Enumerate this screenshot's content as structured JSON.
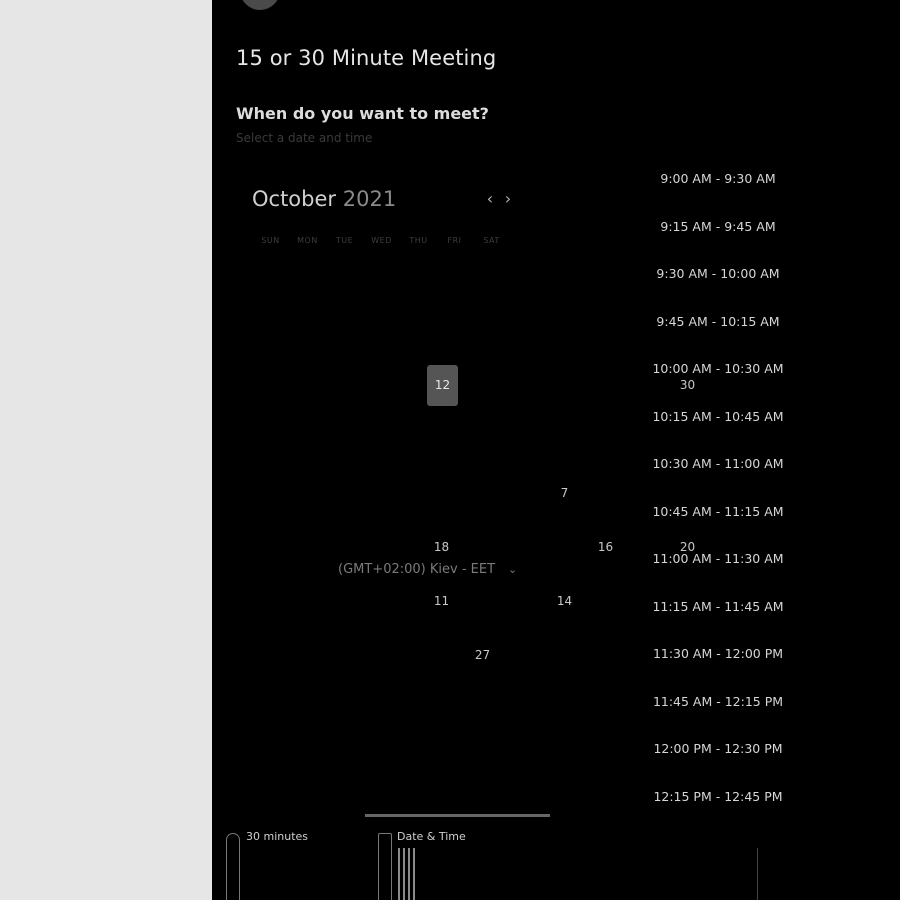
{
  "event": {
    "title": "15 or 30 Minute Meeting",
    "question": "When do you want to meet?",
    "subtitle": "Select a date and time"
  },
  "calendar": {
    "month": "October",
    "year": "2021",
    "prev_icon": "chevron-left-icon",
    "next_icon": "chevron-right-icon",
    "weekdays": [
      "SUN",
      "MON",
      "TUE",
      "WED",
      "THU",
      "FRI",
      "SAT"
    ],
    "days": {
      "selected": "12",
      "d30": "30",
      "d7": "7",
      "d18": "18",
      "d16": "16",
      "d20": "20",
      "d11": "11",
      "d14": "14",
      "d27": "27"
    }
  },
  "timezone": {
    "value": "(GMT+02:00) Kiev - EET",
    "icon": "chevron-down-icon"
  },
  "time_slots": [
    "9:00 AM - 9:30 AM",
    "9:15 AM - 9:45 AM",
    "9:30 AM - 10:00 AM",
    "9:45 AM - 10:15 AM",
    "10:00 AM - 10:30 AM",
    "10:15 AM - 10:45 AM",
    "10:30 AM - 11:00 AM",
    "10:45 AM - 11:15 AM",
    "11:00 AM - 11:30 AM",
    "11:15 AM - 11:45 AM",
    "11:30 AM - 12:00 PM",
    "11:45 AM - 12:15 PM",
    "12:00 PM - 12:30 PM",
    "12:15 PM - 12:45 PM"
  ],
  "steps": {
    "duration": "30 minutes",
    "datetime": "Date & Time"
  }
}
